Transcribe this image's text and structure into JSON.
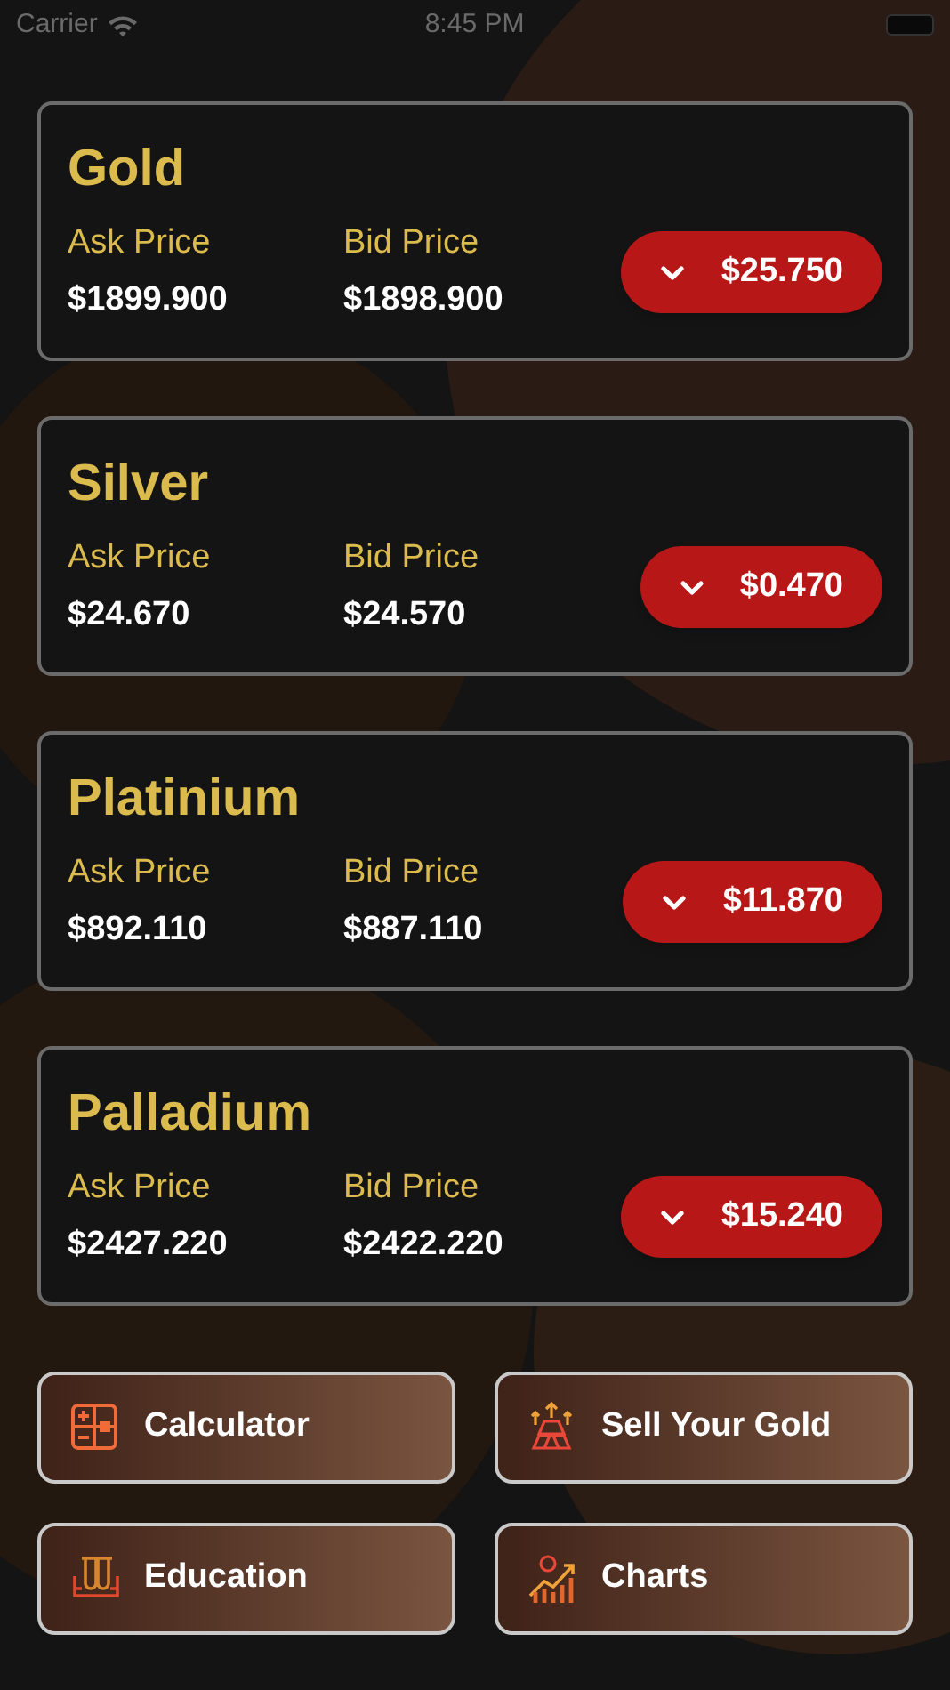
{
  "status_bar": {
    "carrier": "Carrier",
    "time": "8:45 PM"
  },
  "metals": [
    {
      "name": "Gold",
      "ask_label": "Ask Price",
      "ask": "$1899.900",
      "bid_label": "Bid Price",
      "bid": "$1898.900",
      "change": "$25.750"
    },
    {
      "name": "Silver",
      "ask_label": "Ask Price",
      "ask": "$24.670",
      "bid_label": "Bid Price",
      "bid": "$24.570",
      "change": "$0.470"
    },
    {
      "name": "Platinium",
      "ask_label": "Ask Price",
      "ask": "$892.110",
      "bid_label": "Bid Price",
      "bid": "$887.110",
      "change": "$11.870"
    },
    {
      "name": "Palladium",
      "ask_label": "Ask Price",
      "ask": "$2427.220",
      "bid_label": "Bid Price",
      "bid": "$2422.220",
      "change": "$15.240"
    }
  ],
  "actions": [
    {
      "label": "Calculator",
      "kind": "calculator"
    },
    {
      "label": "Sell Your Gold",
      "kind": "sell"
    },
    {
      "label": "Education",
      "kind": "education"
    },
    {
      "label": "Charts",
      "kind": "charts"
    }
  ]
}
